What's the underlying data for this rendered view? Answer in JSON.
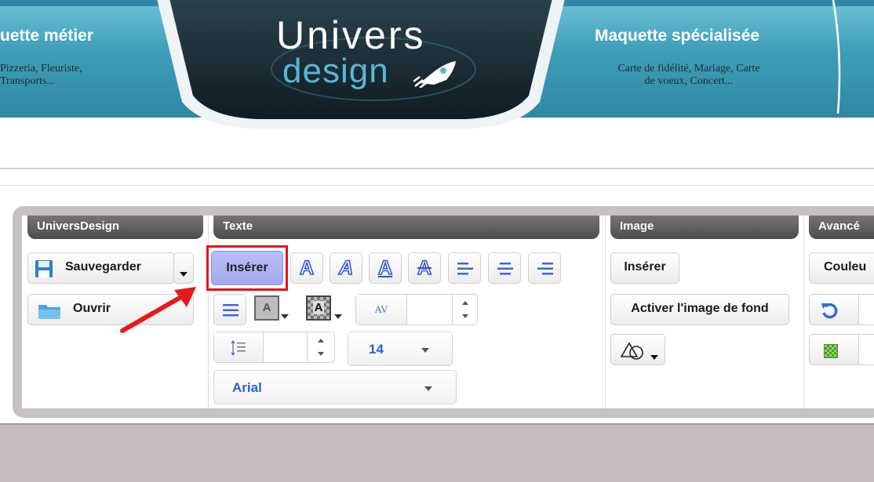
{
  "banner": {
    "left_title": "uette métier",
    "left_sub_line1": "Pizzeria, Fleuriste,",
    "left_sub_line2": "Transports...",
    "right_title": "Maquette spécialisée",
    "right_sub_line1": "Carte de fidélité, Mariage, Carte",
    "right_sub_line2": "de voeux, Concert...",
    "logo_word": "Univers",
    "logo_sub": "design"
  },
  "toolbar": {
    "sections": {
      "universdesign": "UniversDesign",
      "texte": "Texte",
      "image": "Image",
      "avance": "Avancé"
    },
    "save_label": "Sauvegarder",
    "open_label": "Ouvrir",
    "insert_text_label": "Insérer",
    "insert_image_label": "Insérer",
    "bg_image_label": "Activer l'image de fond",
    "color_label": "Couleu",
    "spacing_glyph": "AV",
    "font_size": "14",
    "font_name": "Arial",
    "letter_spacing_value": "",
    "line_height_value": ""
  },
  "colors": {
    "banner_teal": "#3f9db8",
    "highlight_red": "#e3131b",
    "insert_active_bg": "#aeb3f3",
    "section_header": "#5e5c5c",
    "arrow_red": "#e41b1b"
  }
}
